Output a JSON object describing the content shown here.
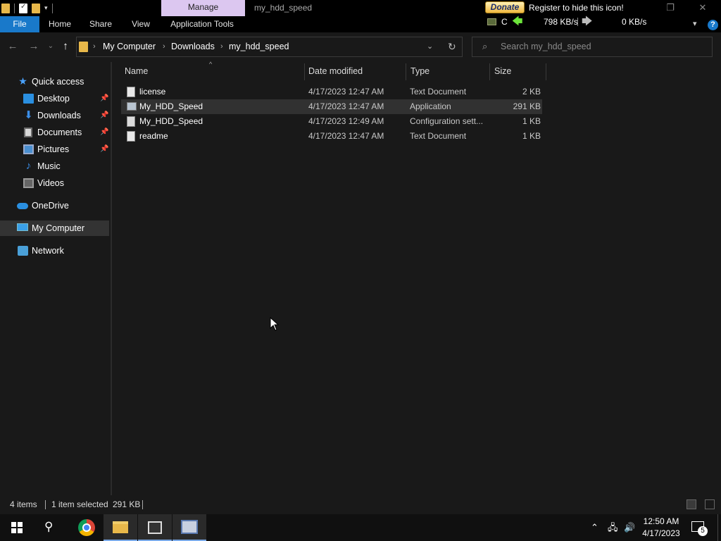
{
  "titlebar": {
    "qat_dropdown": "▾",
    "manage_tab": "Manage",
    "window_title": "my_hdd_speed",
    "donate_label": "Donate",
    "register_text": "Register to hide this icon!",
    "restore_glyph": "❐",
    "close_glyph": "✕"
  },
  "ribbon": {
    "tabs": [
      "File",
      "Home",
      "Share",
      "View",
      "Application Tools"
    ],
    "drive_letter": "C",
    "read_speed": "798 KB/s",
    "write_speed": "0 KB/s",
    "help": "?"
  },
  "address": {
    "breadcrumbs": [
      "My Computer",
      "Downloads",
      "my_hdd_speed"
    ],
    "search_placeholder": "Search my_hdd_speed"
  },
  "nav": {
    "quick_access": "Quick access",
    "items": [
      {
        "label": "Desktop",
        "pinned": true
      },
      {
        "label": "Downloads",
        "pinned": true
      },
      {
        "label": "Documents",
        "pinned": true
      },
      {
        "label": "Pictures",
        "pinned": true
      },
      {
        "label": "Music",
        "pinned": false
      },
      {
        "label": "Videos",
        "pinned": false
      }
    ],
    "onedrive": "OneDrive",
    "my_computer": "My Computer",
    "network": "Network"
  },
  "columns": {
    "name": "Name",
    "date": "Date modified",
    "type": "Type",
    "size": "Size"
  },
  "files": [
    {
      "name": "license",
      "date": "4/17/2023 12:47 AM",
      "type": "Text Document",
      "size": "2 KB",
      "kind": "text",
      "selected": false
    },
    {
      "name": "My_HDD_Speed",
      "date": "4/17/2023 12:47 AM",
      "type": "Application",
      "size": "291 KB",
      "kind": "app",
      "selected": true
    },
    {
      "name": "My_HDD_Speed",
      "date": "4/17/2023 12:49 AM",
      "type": "Configuration sett...",
      "size": "1 KB",
      "kind": "config",
      "selected": false
    },
    {
      "name": "readme",
      "date": "4/17/2023 12:47 AM",
      "type": "Text Document",
      "size": "1 KB",
      "kind": "text",
      "selected": false
    }
  ],
  "status": {
    "item_count": "4 items",
    "selection": "1 item selected",
    "selection_size": "291 KB"
  },
  "taskbar": {
    "time": "12:50 AM",
    "date": "4/17/2023",
    "notification_count": "5"
  }
}
